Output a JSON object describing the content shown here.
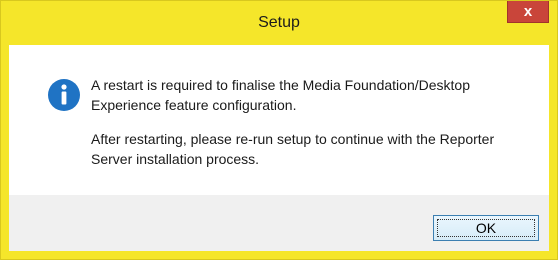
{
  "window": {
    "title": "Setup",
    "close_label": "x"
  },
  "message": {
    "line1": "A restart is required to finalise the Media Foundation/Desktop Experience feature configuration.",
    "line2": "After restarting, please re-run setup to continue with the Reporter Server installation process."
  },
  "icon": "info-icon",
  "buttons": {
    "ok_label": "OK"
  },
  "colors": {
    "titlebar": "#f5e62a",
    "close_button": "#c9453a",
    "info_icon": "#1f73c4"
  }
}
